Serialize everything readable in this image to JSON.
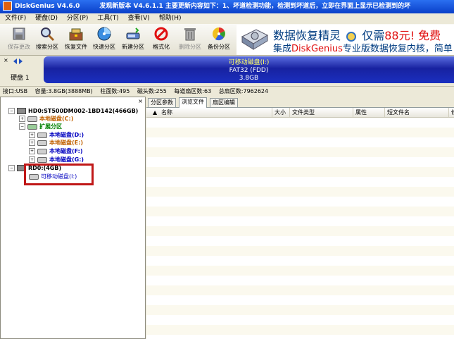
{
  "window": {
    "title": "DiskGenius V4.6.0",
    "notice": "发现新版本 V4.6.1.1 主要更新内容如下：1、坏道检测功能，检测到坏道后，立即在界面上显示已检测到的坏"
  },
  "menu": [
    "文件(F)",
    "硬盘(D)",
    "分区(P)",
    "工具(T)",
    "查看(V)",
    "帮助(H)"
  ],
  "toolbar": [
    {
      "label": "保存更改",
      "icon": "save-icon",
      "enabled": false
    },
    {
      "label": "搜索分区",
      "icon": "search-icon",
      "enabled": true
    },
    {
      "label": "恢复文件",
      "icon": "recover-icon",
      "enabled": true
    },
    {
      "label": "快速分区",
      "icon": "quick-partition-icon",
      "enabled": true
    },
    {
      "label": "新建分区",
      "icon": "new-partition-icon",
      "enabled": true
    },
    {
      "label": "格式化",
      "icon": "format-icon",
      "enabled": true
    },
    {
      "label": "删除分区",
      "icon": "delete-icon",
      "enabled": false
    },
    {
      "label": "备份分区",
      "icon": "backup-icon",
      "enabled": true
    }
  ],
  "ad": {
    "line1_prefix": "数据恢复精灵",
    "line1_mid": "仅需",
    "line1_price": "88元!",
    "line1_suffix": "免费",
    "line2_prefix": "集成",
    "line2_brand": "DiskGenius",
    "line2_suffix": "专业版数据恢复内核，简单"
  },
  "diskbar": {
    "disk_label": "硬盘 1",
    "partition_name": "可移动磁盘(I:)",
    "partition_fs": "FAT32 (FDD)",
    "partition_size": "3.8GB"
  },
  "info": {
    "interface": "接口:USB",
    "capacity": "容量:3.8GB(3888MB)",
    "cylinders": "柱面数:495",
    "heads": "磁头数:255",
    "sectors_per_track": "每道扇区数:63",
    "total_sectors": "总扇区数:7962624"
  },
  "tree": {
    "hd0": "HD0:ST500DM002-1BD142(466GB)",
    "hd0_c": "本地磁盘(C:)",
    "hd0_ext": "扩展分区",
    "hd0_d": "本地磁盘(D:)",
    "hd0_e": "本地磁盘(E:)",
    "hd0_f": "本地磁盘(F:)",
    "hd0_g": "本地磁盘(G:)",
    "rd0": "RD0:(4GB)",
    "rd0_i": "可移动磁盘(I:)"
  },
  "tabs": [
    "分区参数",
    "浏览文件",
    "扇区编辑"
  ],
  "columns": [
    "名称",
    "大小",
    "文件类型",
    "属性",
    "短文件名",
    "修"
  ],
  "colors": {
    "titlebar": "#0a3fc9",
    "partition_bar": "#1822a0",
    "highlight": "#c01818"
  }
}
